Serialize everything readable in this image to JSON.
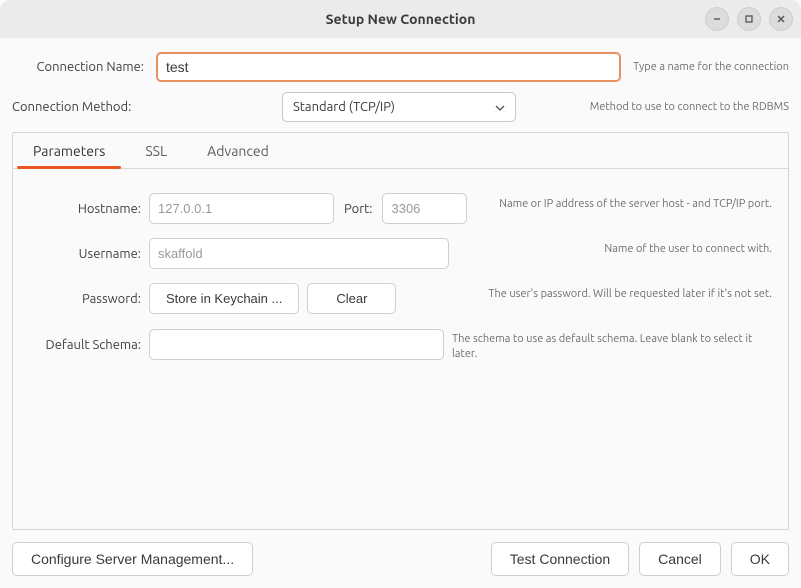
{
  "window": {
    "title": "Setup New Connection"
  },
  "header": {
    "connection_name_label": "Connection Name:",
    "connection_name_value": "test",
    "connection_name_hint": "Type a name for the connection",
    "connection_method_label": "Connection Method:",
    "connection_method_value": "Standard (TCP/IP)",
    "connection_method_hint": "Method to use to connect to the RDBMS"
  },
  "tabs": {
    "parameters": "Parameters",
    "ssl": "SSL",
    "advanced": "Advanced"
  },
  "form": {
    "hostname_label": "Hostname:",
    "hostname_value": "127.0.0.1",
    "port_label": "Port:",
    "port_value": "3306",
    "host_hint": "Name or IP address of the server host - and TCP/IP port.",
    "username_label": "Username:",
    "username_value": "skaffold",
    "username_hint": "Name of the user to connect with.",
    "password_label": "Password:",
    "password_store_btn": "Store in Keychain ...",
    "password_clear_btn": "Clear",
    "password_hint": "The user's password. Will be requested later if it's not set.",
    "schema_label": "Default Schema:",
    "schema_value": "",
    "schema_hint": "The schema to use as default schema. Leave blank to select it later."
  },
  "footer": {
    "configure_btn": "Configure Server Management...",
    "test_btn": "Test Connection",
    "cancel_btn": "Cancel",
    "ok_btn": "OK"
  }
}
